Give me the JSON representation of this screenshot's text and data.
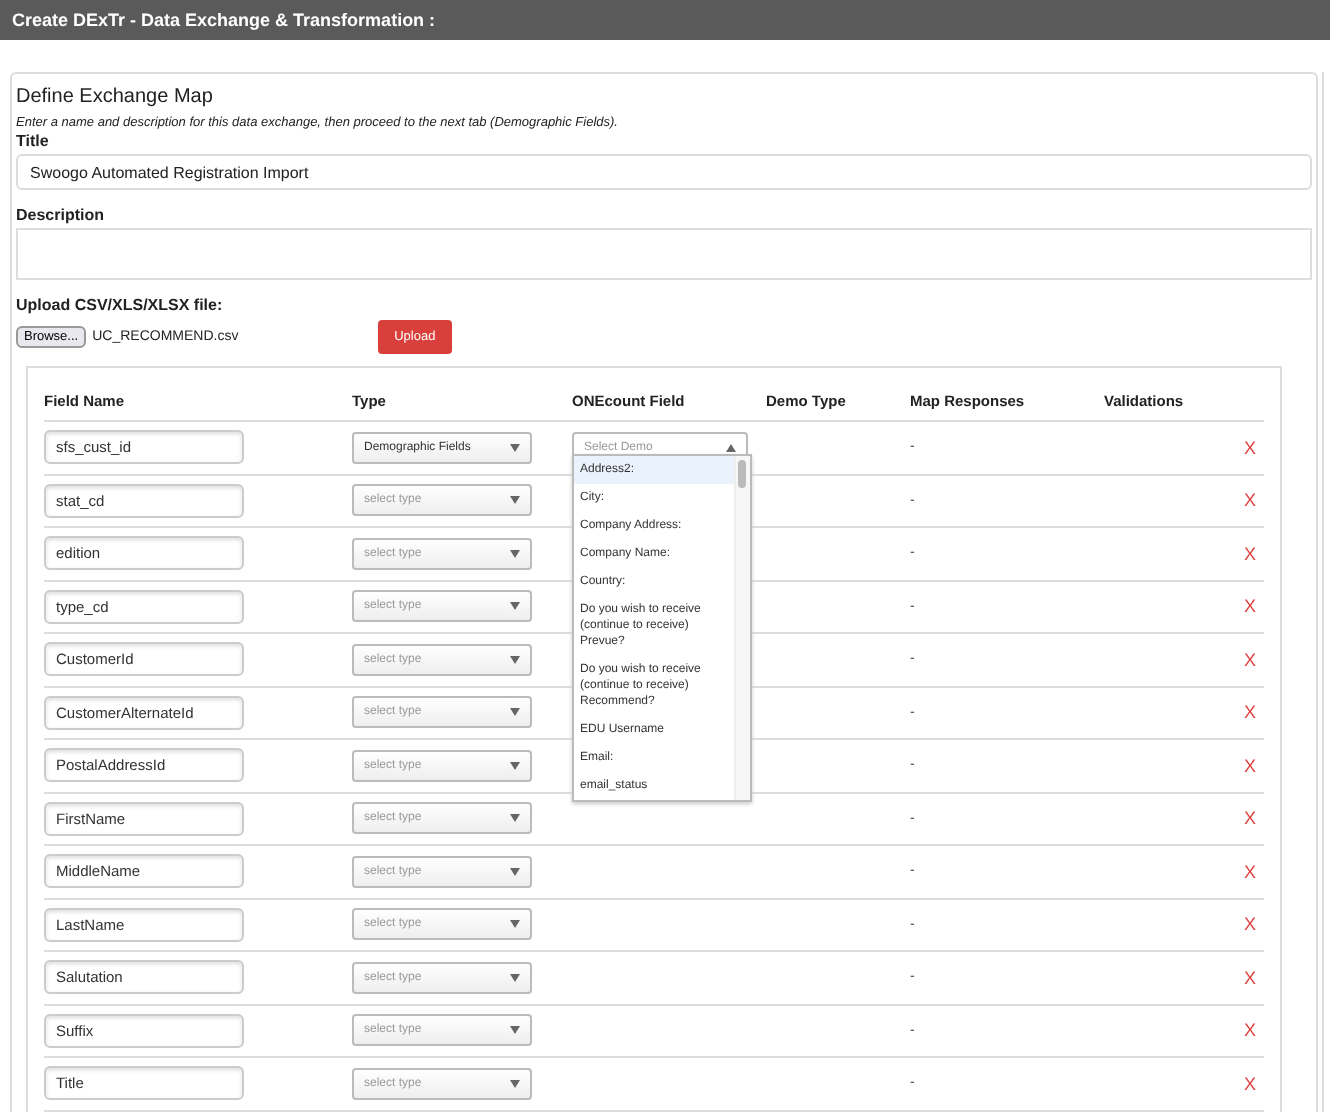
{
  "header": {
    "title": "Create DExTr - Data Exchange & Transformation :"
  },
  "form": {
    "heading": "Define Exchange Map",
    "instructions": "Enter a name and description for this data exchange, then proceed to the next tab (Demographic Fields).",
    "title_label": "Title",
    "title_value": "Swoogo Automated Registration Import",
    "description_label": "Description",
    "upload_label": "Upload CSV/XLS/XLSX file:",
    "browse_button": "Browse...",
    "file_name": "UC_RECOMMEND.csv",
    "upload_button": "Upload"
  },
  "table": {
    "columns": [
      "Field Name",
      "Type",
      "ONEcount Field",
      "Demo Type",
      "Map Responses",
      "Validations"
    ],
    "rows": [
      {
        "field_name": "sfs_cust_id",
        "type": {
          "value": "Demographic Fields"
        },
        "onecount": {
          "placeholder": "Select Demo",
          "expanded": true
        },
        "map_responses": "-",
        "remove": "X"
      },
      {
        "field_name": "stat_cd",
        "type": {
          "placeholder": "select type"
        },
        "map_responses": "-",
        "remove": "X"
      },
      {
        "field_name": "edition",
        "type": {
          "placeholder": "select type"
        },
        "map_responses": "-",
        "remove": "X"
      },
      {
        "field_name": "type_cd",
        "type": {
          "placeholder": "select type"
        },
        "map_responses": "-",
        "remove": "X"
      },
      {
        "field_name": "CustomerId",
        "type": {
          "placeholder": "select type"
        },
        "map_responses": "-",
        "remove": "X"
      },
      {
        "field_name": "CustomerAlternateId",
        "type": {
          "placeholder": "select type"
        },
        "map_responses": "-",
        "remove": "X"
      },
      {
        "field_name": "PostalAddressId",
        "type": {
          "placeholder": "select type"
        },
        "map_responses": "-",
        "remove": "X"
      },
      {
        "field_name": "FirstName",
        "type": {
          "placeholder": "select type"
        },
        "map_responses": "-",
        "remove": "X"
      },
      {
        "field_name": "MiddleName",
        "type": {
          "placeholder": "select type"
        },
        "map_responses": "-",
        "remove": "X"
      },
      {
        "field_name": "LastName",
        "type": {
          "placeholder": "select type"
        },
        "map_responses": "-",
        "remove": "X"
      },
      {
        "field_name": "Salutation",
        "type": {
          "placeholder": "select type"
        },
        "map_responses": "-",
        "remove": "X"
      },
      {
        "field_name": "Suffix",
        "type": {
          "placeholder": "select type"
        },
        "map_responses": "-",
        "remove": "X"
      },
      {
        "field_name": "Title",
        "type": {
          "placeholder": "select type"
        },
        "map_responses": "-",
        "remove": "X"
      }
    ]
  },
  "dropdown": {
    "options": [
      {
        "label": "Address2:",
        "selected": true
      },
      {
        "label": "City:",
        "selected": false
      },
      {
        "label": "Company Address:",
        "selected": false
      },
      {
        "label": "Company Name:",
        "selected": false
      },
      {
        "label": "Country:",
        "selected": false
      },
      {
        "label": "Do you wish to receive (continue to receive) Prevue?",
        "selected": false
      },
      {
        "label": "Do you wish to receive (continue to receive) Recommend?",
        "selected": false
      },
      {
        "label": "EDU Username",
        "selected": false
      },
      {
        "label": "Email:",
        "selected": false
      },
      {
        "label": "email_status",
        "selected": false
      }
    ]
  }
}
